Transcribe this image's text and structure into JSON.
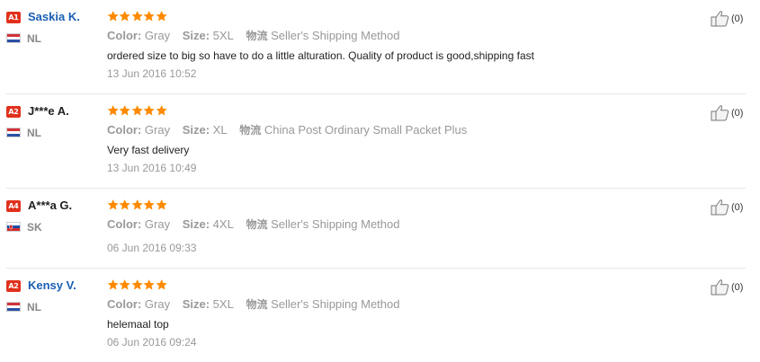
{
  "labels": {
    "color": "Color:",
    "size": "Size:",
    "shipping": "物流"
  },
  "colors": {
    "name_link": "#1a5fb4",
    "badge": "#e0311d",
    "star": "#ff8a00",
    "divider": "#e8e8e8"
  },
  "reviews": [
    {
      "badge": "A1",
      "name": "Saskia K.",
      "name_linked": true,
      "country": "NL",
      "flag": "flag-netherlands-icon",
      "rating": 5,
      "color": "Gray",
      "size": "5XL",
      "shipping": "Seller's Shipping Method",
      "text": "ordered size to big so have to do a little alturation. Quality of product is good,shipping fast",
      "date": "13 Jun 2016 10:52",
      "likes": "(0)"
    },
    {
      "badge": "A2",
      "name": "J***e A.",
      "name_linked": false,
      "country": "NL",
      "flag": "flag-netherlands-icon",
      "rating": 5,
      "color": "Gray",
      "size": "XL",
      "shipping": "China Post Ordinary Small Packet Plus",
      "text": "Very fast delivery",
      "date": "13 Jun 2016 10:49",
      "likes": "(0)"
    },
    {
      "badge": "A4",
      "name": "A***a G.",
      "name_linked": false,
      "country": "SK",
      "flag": "flag-slovakia-icon",
      "rating": 5,
      "color": "Gray",
      "size": "4XL",
      "shipping": "Seller's Shipping Method",
      "text": "",
      "date": "06 Jun 2016 09:33",
      "likes": "(0)"
    },
    {
      "badge": "A2",
      "name": "Kensy V.",
      "name_linked": true,
      "country": "NL",
      "flag": "flag-netherlands-icon",
      "rating": 5,
      "color": "Gray",
      "size": "5XL",
      "shipping": "Seller's Shipping Method",
      "text": "helemaal top",
      "date": "06 Jun 2016 09:24",
      "likes": "(0)"
    }
  ]
}
